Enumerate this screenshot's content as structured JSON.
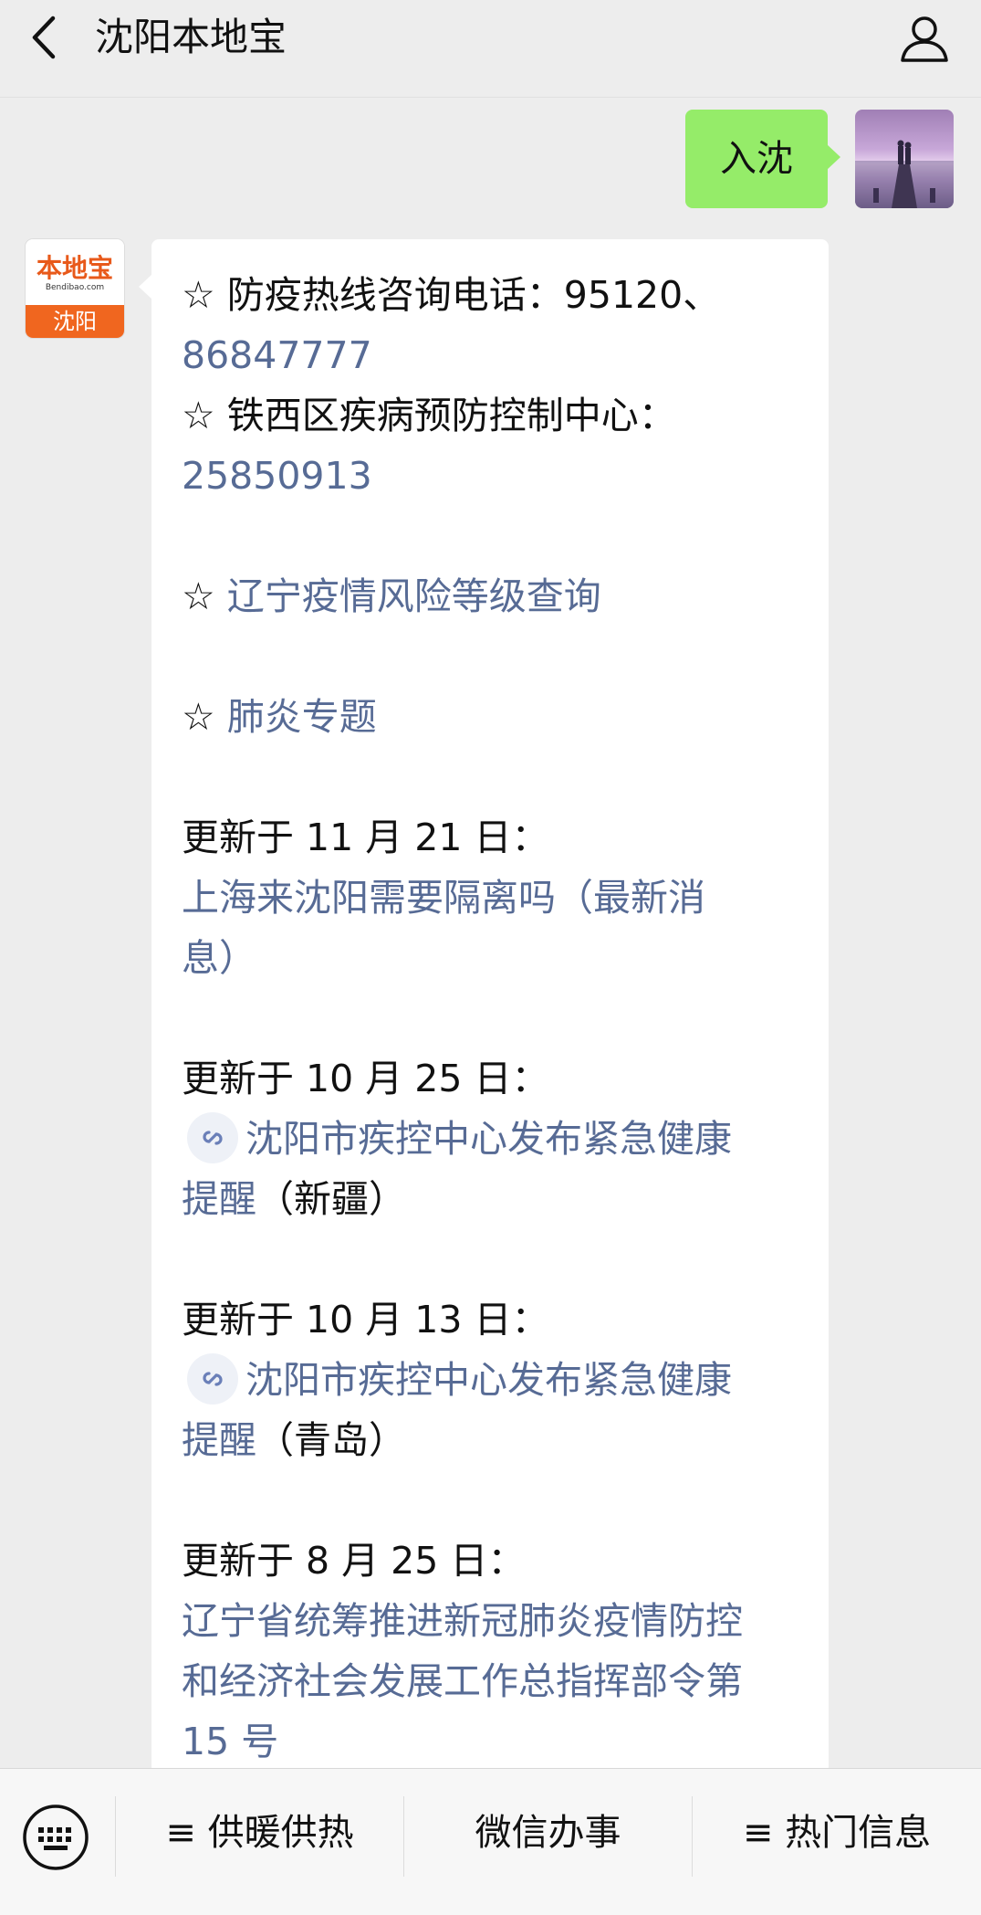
{
  "header": {
    "title": "沈阳本地宝"
  },
  "sent_message": {
    "text": "入沈"
  },
  "bot_avatar": {
    "brand": "本地宝",
    "domain": "Bendibao.com",
    "city": "沈阳"
  },
  "message": {
    "l1a": "☆ 防疫热线咨询电话：95120、",
    "l1b": "86847777",
    "l2a": "☆ 铁西区疾病预防控制中心：",
    "l2b": "25850913",
    "l3_star": "☆ ",
    "l3_link": "辽宁疫情风险等级查询",
    "l4_star": "☆ ",
    "l4_link": "肺炎专题",
    "u1_date": "更新于 11 月 21 日：",
    "u1_link_a": "上海来沈阳需要隔离吗（最新消",
    "u1_link_b": "息）",
    "u2_date": "更新于 10 月 25 日：",
    "u2_link_a": "沈阳市疾控中心发布紧急健康",
    "u2_link_b": "提醒",
    "u2_suffix": "（新疆）",
    "u3_date": "更新于 10 月 13 日：",
    "u3_link_a": "沈阳市疾控中心发布紧急健康",
    "u3_link_b": "提醒",
    "u3_suffix": "（青岛）",
    "u4_date": "更新于 8 月 25 日：",
    "u4_link_a": "辽宁省统筹推进新冠肺炎疫情防控",
    "u4_link_b": "和经济社会发展工作总指挥部令第",
    "u4_link_c": "15 号"
  },
  "bottom_menu": {
    "item1": "≡ 供暖供热",
    "item2": "微信办事",
    "item3": "≡ 热门信息"
  },
  "colors": {
    "link": "#576b95",
    "sent_bubble": "#95ec69",
    "brand_orange": "#f0661f"
  }
}
